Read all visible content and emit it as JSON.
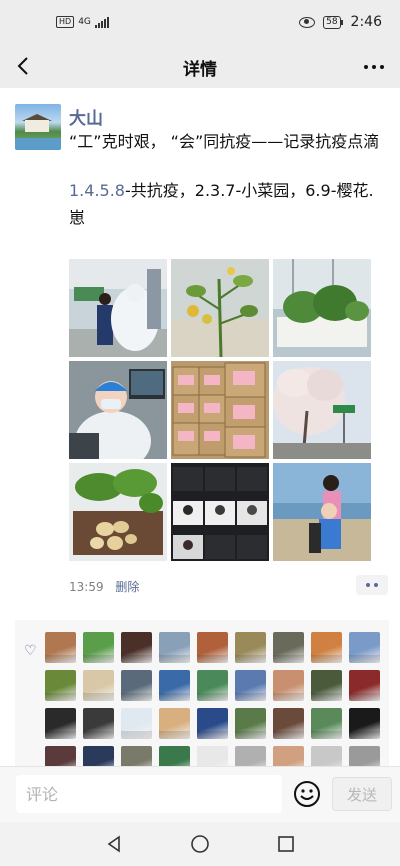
{
  "status_bar": {
    "network": "4G",
    "signal_icon": "signal-bars-icon",
    "battery": "58",
    "time": "2:46"
  },
  "nav": {
    "title": "详情",
    "back_icon": "chevron-left-icon",
    "more_icon": "more-dots-icon"
  },
  "post": {
    "author": "大山",
    "title_text": "“工”克时艰， “会”同抗疫——记录抗疫点滴",
    "caption_link": "1.4.5.8",
    "caption_rest": "-共抗疫，2.3.7-小菜园，6.9-樱花.崽",
    "images": [
      "photo-volunteer-ppe",
      "photo-tomato-plant",
      "photo-balcony-planter",
      "photo-worker-in-protective-suit",
      "photo-supply-boxes",
      "photo-cherry-blossoms",
      "photo-harvested-potatoes",
      "photo-video-conference",
      "photo-child-at-riverside"
    ],
    "time": "13:59",
    "delete_label": "删除"
  },
  "likes": {
    "icon": "heart-icon",
    "avatar_colors": [
      "#b07850",
      "#5a9e4a",
      "#4a3028",
      "#8aa0b8",
      "#b0603a",
      "#9a8a5a",
      "#6a6a5a",
      "#d08040",
      "#7a9ac8",
      "#6a8a3a",
      "#d8c8a8",
      "#5a6a7a",
      "#3a6aa8",
      "#4a8a5a",
      "#5a7ab0",
      "#c89070",
      "#4a5a3a",
      "#8a2a2a",
      "#2a2a2a",
      "#3a3a3a",
      "#e0e8f0",
      "#d8b080",
      "#2a4a8a",
      "#5a7a4a",
      "#6a4a3a",
      "#5a8a5a",
      "#1a1a1a",
      "#5a3a3a",
      "#2a3a5a",
      "#7a7a6a",
      "#3a7a4a",
      "#e8e8e8",
      "#b0b0b0",
      "#d0a080",
      "#c8c8c8",
      "#9a9a9a"
    ]
  },
  "comment_bar": {
    "placeholder": "评论",
    "emoji_icon": "smiley-face-icon",
    "send_label": "发送"
  },
  "system_nav": {
    "back_icon": "triangle-back-icon",
    "home_icon": "circle-home-icon",
    "recents_icon": "square-recents-icon"
  }
}
